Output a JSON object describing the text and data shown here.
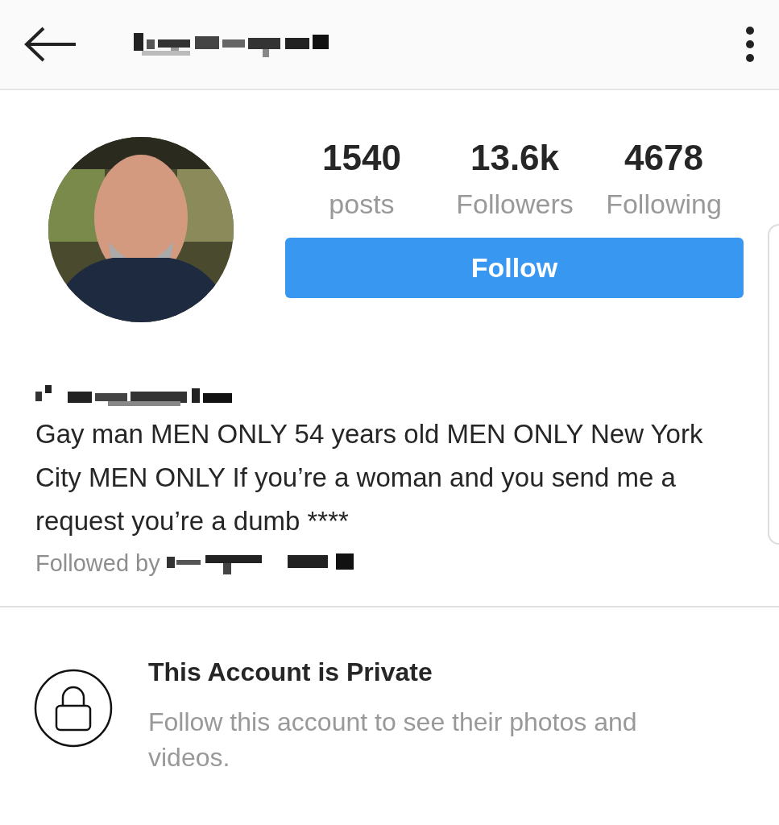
{
  "profile": {
    "stats": [
      {
        "value": "1540",
        "label": "posts"
      },
      {
        "value": "13.6k",
        "label": "Followers"
      },
      {
        "value": "4678",
        "label": "Following"
      }
    ],
    "follow_button": "Follow",
    "bio": "Gay man MEN ONLY 54 years old MEN ONLY New York City MEN ONLY If you’re a woman and you send me a request you’re a dumb ****",
    "followed_by": "Followed by"
  },
  "private_notice": {
    "title": "This Account is Private",
    "message": "Follow this account to see their photos and videos."
  }
}
